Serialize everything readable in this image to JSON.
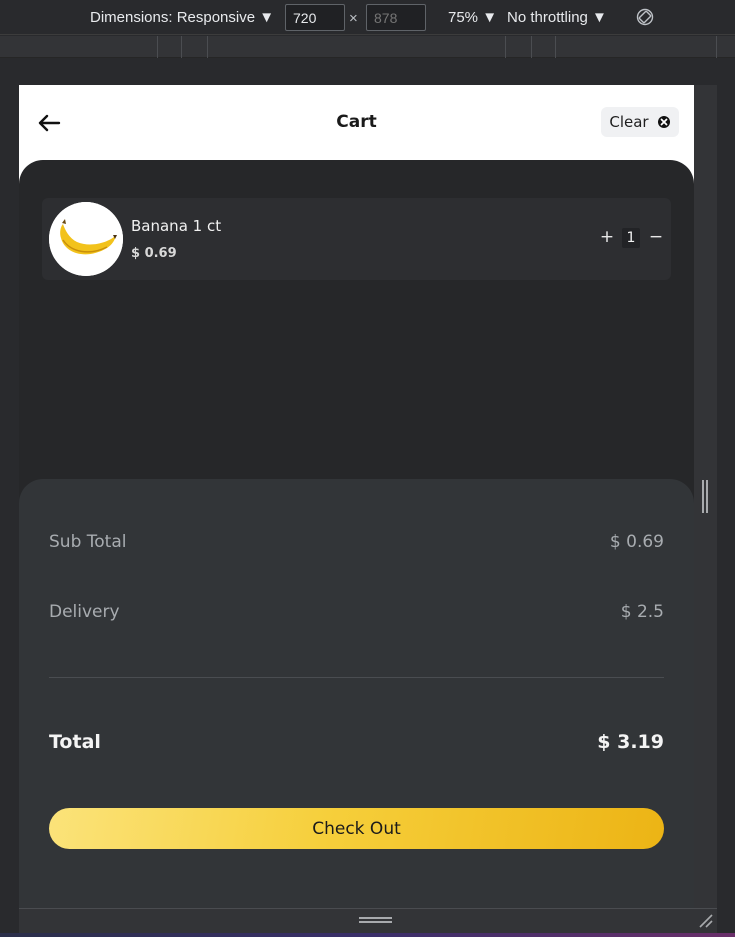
{
  "devtools": {
    "dimensions_label": "Dimensions: Responsive ▼",
    "width_value": "720",
    "height_placeholder": "878",
    "times": "×",
    "zoom_label": "75% ▼",
    "throttle_label": "No throttling ▼",
    "icons": [
      "rotate-icon",
      "resize-corner-icon"
    ]
  },
  "header": {
    "title": "Cart",
    "clear_label": "Clear",
    "icons": [
      "back-arrow-icon",
      "clear-x-icon"
    ]
  },
  "cart": {
    "items": [
      {
        "name": "Banana 1 ct",
        "price": "$ 0.69",
        "quantity": "1",
        "plus": "+",
        "minus": "−",
        "image": "banana-image"
      }
    ]
  },
  "summary": {
    "subtotal_label": "Sub Total",
    "subtotal_value": "$ 0.69",
    "delivery_label": "Delivery",
    "delivery_value": "$ 2.5",
    "total_label": "Total",
    "total_value": "$ 3.19",
    "checkout_label": "Check Out"
  },
  "colors": {
    "page_dark": "#262729",
    "summary_panel": "#323538",
    "checkout_gradient_start": "#fbe37a",
    "checkout_gradient_end": "#ecb415"
  }
}
